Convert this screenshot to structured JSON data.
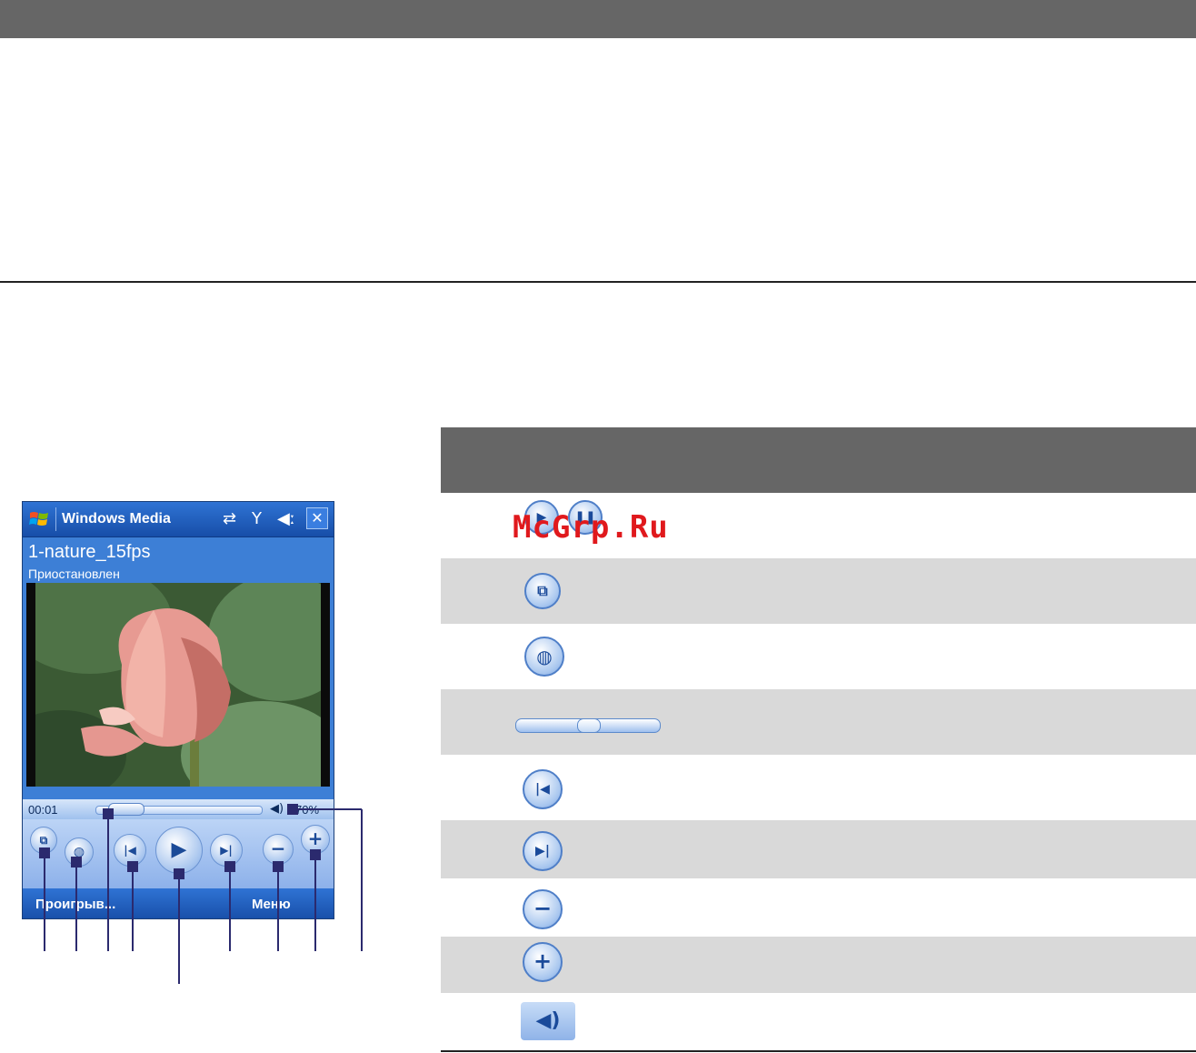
{
  "player": {
    "window_title": "Windows Media",
    "track_name": "1-nature_15fps",
    "track_status": "Приостановлен",
    "elapsed_time": "00:01",
    "volume": "70%",
    "seek_position": 0.1,
    "soft_left": "Проигрыв...",
    "soft_right": "Меню",
    "title_icons": [
      "sync-icon",
      "signal-icon",
      "speaker-icon",
      "close-icon"
    ],
    "control_icons": [
      "full-screen-icon",
      "web-icon",
      "previous-icon",
      "play-icon",
      "next-icon",
      "volume-down-icon",
      "volume-up-icon"
    ]
  },
  "table": {
    "rows": [
      {
        "icon": "play-pause-icon",
        "shade": "#ffffff"
      },
      {
        "icon": "full-screen-icon",
        "shade": "#d9d9d9"
      },
      {
        "icon": "web-icon",
        "shade": "#ffffff"
      },
      {
        "icon": "seek-bar-icon",
        "shade": "#d9d9d9"
      },
      {
        "icon": "previous-icon",
        "shade": "#ffffff"
      },
      {
        "icon": "next-icon",
        "shade": "#d9d9d9"
      },
      {
        "icon": "volume-down-icon",
        "shade": "#ffffff"
      },
      {
        "icon": "volume-up-icon",
        "shade": "#d9d9d9"
      },
      {
        "icon": "speaker-icon",
        "shade": "#ffffff"
      }
    ]
  },
  "watermark": "McGrp.Ru",
  "colors": {
    "header_gray": "#666666",
    "row_gray": "#d9d9d9",
    "device_blue": "#3d7fd6",
    "callout_navy": "#2b2a6e",
    "watermark_red": "#e0191d"
  }
}
